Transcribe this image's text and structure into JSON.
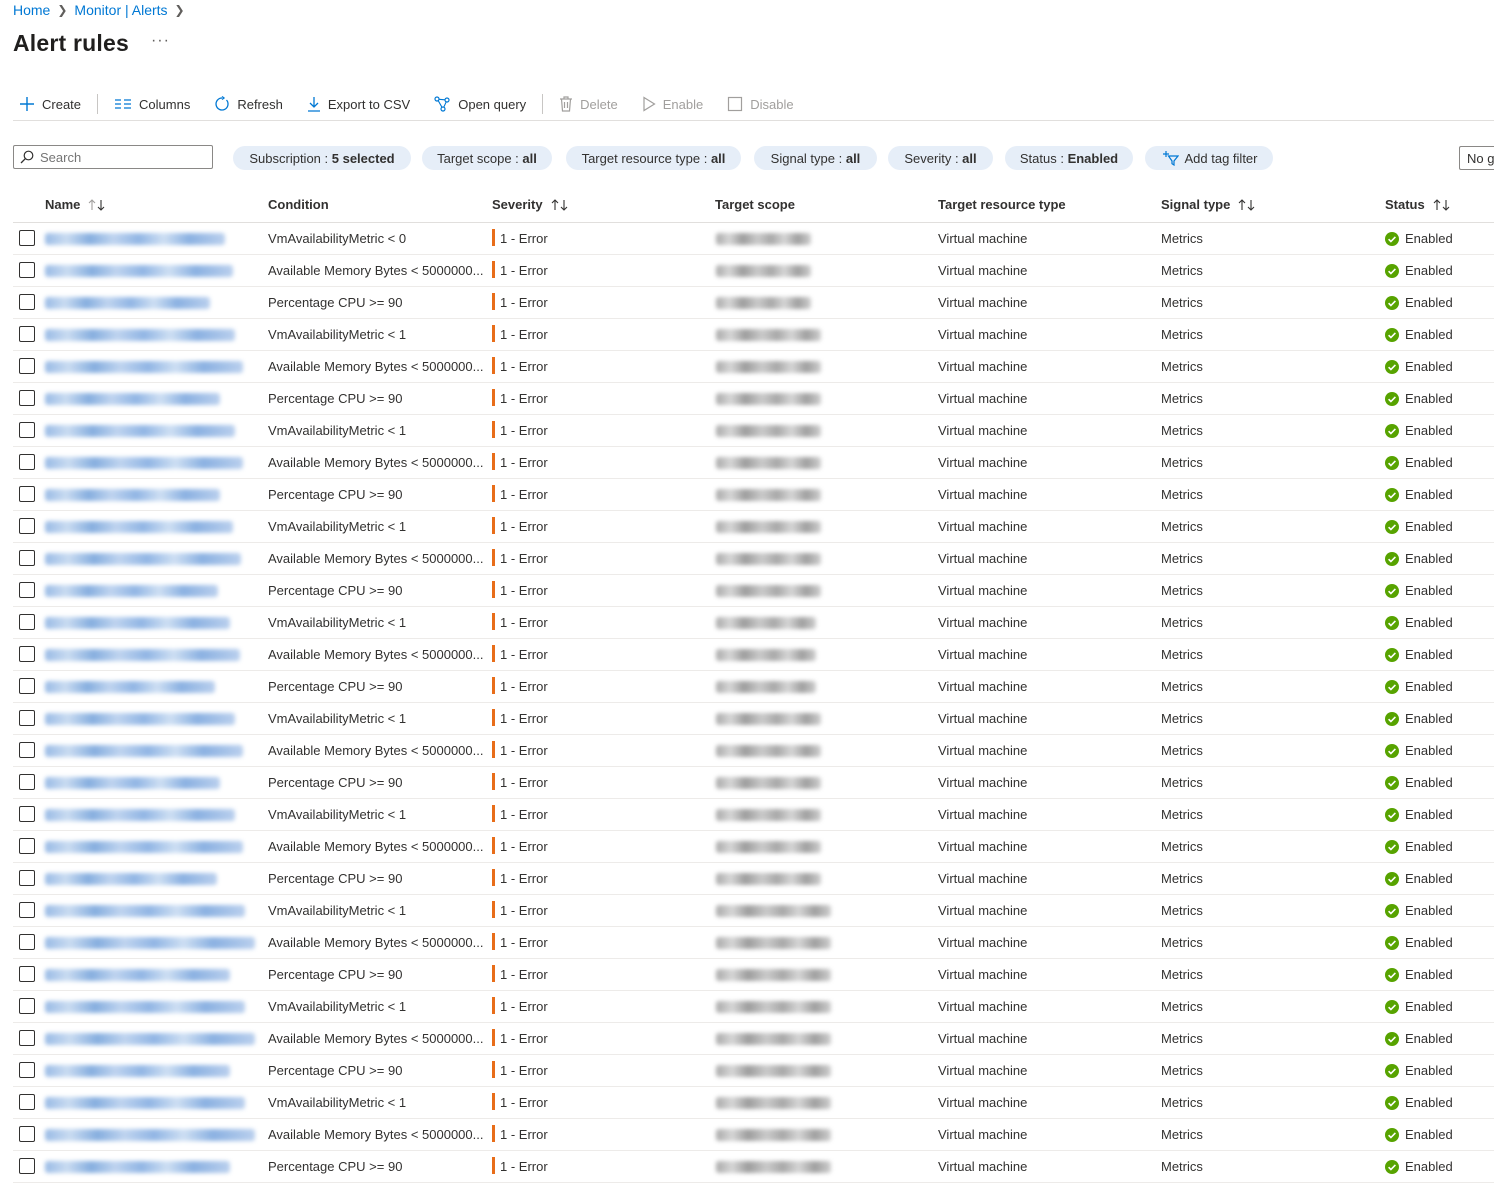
{
  "breadcrumb": {
    "home": "Home",
    "monitor": "Monitor | Alerts"
  },
  "page": {
    "title": "Alert rules",
    "more": "···"
  },
  "toolbar": {
    "create": "Create",
    "columns": "Columns",
    "refresh": "Refresh",
    "export": "Export to CSV",
    "open_query": "Open query",
    "delete": "Delete",
    "enable": "Enable",
    "disable": "Disable"
  },
  "search": {
    "placeholder": "Search"
  },
  "filters": [
    {
      "key": "Subscription",
      "value": "5 selected"
    },
    {
      "key": "Target scope",
      "value": "all"
    },
    {
      "key": "Target resource type",
      "value": "all"
    },
    {
      "key": "Signal type",
      "value": "all"
    },
    {
      "key": "Severity",
      "value": "all"
    },
    {
      "key": "Status",
      "value": "Enabled"
    }
  ],
  "add_tag_filter": "Add tag filter",
  "grouping": "No grouping",
  "columns": {
    "name": "Name",
    "condition": "Condition",
    "severity": "Severity",
    "target_scope": "Target scope",
    "target_resource_type": "Target resource type",
    "signal_type": "Signal type",
    "status": "Status"
  },
  "colors": {
    "accent": "#0078d4",
    "severity_error": "#e86d19",
    "status_ok": "#57a300"
  },
  "rows": [
    {
      "condition": "VmAvailabilityMetric < 0",
      "severity": "1 - Error",
      "resource_type": "Virtual machine",
      "signal": "Metrics",
      "status": "Enabled"
    },
    {
      "condition": "Available Memory Bytes < 5000000...",
      "severity": "1 - Error",
      "resource_type": "Virtual machine",
      "signal": "Metrics",
      "status": "Enabled"
    },
    {
      "condition": "Percentage CPU >= 90",
      "severity": "1 - Error",
      "resource_type": "Virtual machine",
      "signal": "Metrics",
      "status": "Enabled"
    },
    {
      "condition": "VmAvailabilityMetric < 1",
      "severity": "1 - Error",
      "resource_type": "Virtual machine",
      "signal": "Metrics",
      "status": "Enabled"
    },
    {
      "condition": "Available Memory Bytes < 5000000...",
      "severity": "1 - Error",
      "resource_type": "Virtual machine",
      "signal": "Metrics",
      "status": "Enabled"
    },
    {
      "condition": "Percentage CPU >= 90",
      "severity": "1 - Error",
      "resource_type": "Virtual machine",
      "signal": "Metrics",
      "status": "Enabled"
    },
    {
      "condition": "VmAvailabilityMetric < 1",
      "severity": "1 - Error",
      "resource_type": "Virtual machine",
      "signal": "Metrics",
      "status": "Enabled"
    },
    {
      "condition": "Available Memory Bytes < 5000000...",
      "severity": "1 - Error",
      "resource_type": "Virtual machine",
      "signal": "Metrics",
      "status": "Enabled"
    },
    {
      "condition": "Percentage CPU >= 90",
      "severity": "1 - Error",
      "resource_type": "Virtual machine",
      "signal": "Metrics",
      "status": "Enabled"
    },
    {
      "condition": "VmAvailabilityMetric < 1",
      "severity": "1 - Error",
      "resource_type": "Virtual machine",
      "signal": "Metrics",
      "status": "Enabled"
    },
    {
      "condition": "Available Memory Bytes < 5000000...",
      "severity": "1 - Error",
      "resource_type": "Virtual machine",
      "signal": "Metrics",
      "status": "Enabled"
    },
    {
      "condition": "Percentage CPU >= 90",
      "severity": "1 - Error",
      "resource_type": "Virtual machine",
      "signal": "Metrics",
      "status": "Enabled"
    },
    {
      "condition": "VmAvailabilityMetric < 1",
      "severity": "1 - Error",
      "resource_type": "Virtual machine",
      "signal": "Metrics",
      "status": "Enabled"
    },
    {
      "condition": "Available Memory Bytes < 5000000...",
      "severity": "1 - Error",
      "resource_type": "Virtual machine",
      "signal": "Metrics",
      "status": "Enabled"
    },
    {
      "condition": "Percentage CPU >= 90",
      "severity": "1 - Error",
      "resource_type": "Virtual machine",
      "signal": "Metrics",
      "status": "Enabled"
    },
    {
      "condition": "VmAvailabilityMetric < 1",
      "severity": "1 - Error",
      "resource_type": "Virtual machine",
      "signal": "Metrics",
      "status": "Enabled"
    },
    {
      "condition": "Available Memory Bytes < 5000000...",
      "severity": "1 - Error",
      "resource_type": "Virtual machine",
      "signal": "Metrics",
      "status": "Enabled"
    },
    {
      "condition": "Percentage CPU >= 90",
      "severity": "1 - Error",
      "resource_type": "Virtual machine",
      "signal": "Metrics",
      "status": "Enabled"
    },
    {
      "condition": "VmAvailabilityMetric < 1",
      "severity": "1 - Error",
      "resource_type": "Virtual machine",
      "signal": "Metrics",
      "status": "Enabled"
    },
    {
      "condition": "Available Memory Bytes < 5000000...",
      "severity": "1 - Error",
      "resource_type": "Virtual machine",
      "signal": "Metrics",
      "status": "Enabled"
    },
    {
      "condition": "Percentage CPU >= 90",
      "severity": "1 - Error",
      "resource_type": "Virtual machine",
      "signal": "Metrics",
      "status": "Enabled"
    },
    {
      "condition": "VmAvailabilityMetric < 1",
      "severity": "1 - Error",
      "resource_type": "Virtual machine",
      "signal": "Metrics",
      "status": "Enabled"
    },
    {
      "condition": "Available Memory Bytes < 5000000...",
      "severity": "1 - Error",
      "resource_type": "Virtual machine",
      "signal": "Metrics",
      "status": "Enabled"
    },
    {
      "condition": "Percentage CPU >= 90",
      "severity": "1 - Error",
      "resource_type": "Virtual machine",
      "signal": "Metrics",
      "status": "Enabled"
    },
    {
      "condition": "VmAvailabilityMetric < 1",
      "severity": "1 - Error",
      "resource_type": "Virtual machine",
      "signal": "Metrics",
      "status": "Enabled"
    },
    {
      "condition": "Available Memory Bytes < 5000000...",
      "severity": "1 - Error",
      "resource_type": "Virtual machine",
      "signal": "Metrics",
      "status": "Enabled"
    },
    {
      "condition": "Percentage CPU >= 90",
      "severity": "1 - Error",
      "resource_type": "Virtual machine",
      "signal": "Metrics",
      "status": "Enabled"
    },
    {
      "condition": "VmAvailabilityMetric < 1",
      "severity": "1 - Error",
      "resource_type": "Virtual machine",
      "signal": "Metrics",
      "status": "Enabled"
    },
    {
      "condition": "Available Memory Bytes < 5000000...",
      "severity": "1 - Error",
      "resource_type": "Virtual machine",
      "signal": "Metrics",
      "status": "Enabled"
    },
    {
      "condition": "Percentage CPU >= 90",
      "severity": "1 - Error",
      "resource_type": "Virtual machine",
      "signal": "Metrics",
      "status": "Enabled"
    }
  ]
}
